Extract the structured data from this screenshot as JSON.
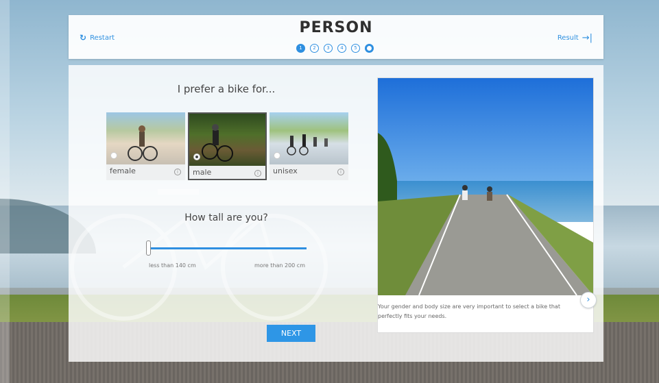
{
  "header": {
    "title": "PERSON",
    "restart_label": "Restart",
    "result_label": "Result",
    "steps": [
      "1",
      "2",
      "3",
      "4",
      "5",
      ""
    ]
  },
  "question1": {
    "text": "I prefer a bike for...",
    "options": [
      {
        "label": "female",
        "selected": false
      },
      {
        "label": "male",
        "selected": true
      },
      {
        "label": "unisex",
        "selected": false
      }
    ]
  },
  "question2": {
    "text": "How tall are you?",
    "min_label": "less than 140 cm",
    "max_label": "more than 200 cm",
    "value_fraction": 0.0
  },
  "next_label": "NEXT",
  "info_card": {
    "text": "Your gender and body size are very important to select a bike that perfectly fits your needs."
  },
  "colors": {
    "accent": "#2e8fe0",
    "button": "#2e96e6"
  }
}
